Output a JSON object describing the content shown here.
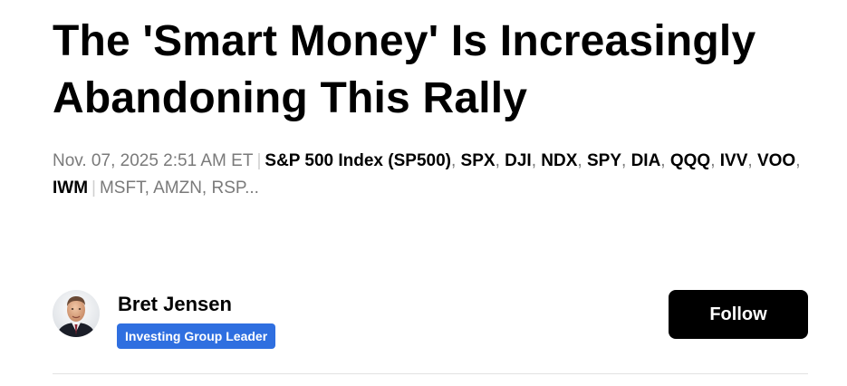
{
  "article": {
    "title": "The 'Smart Money' Is Increasingly Abandoning This Rally",
    "published": "Nov. 07, 2025 2:51 AM ET",
    "separator": "|",
    "primary_tickers": [
      "S&P 500 Index (SP500)",
      "SPX",
      "DJI",
      "NDX",
      "SPY",
      "DIA",
      "QQQ",
      "IVV",
      "VOO",
      "IWM"
    ],
    "secondary_tickers": "MSFT, AMZN, RSP...",
    "comma": ","
  },
  "author": {
    "name": "Bret Jensen",
    "badge": "Investing Group Leader",
    "avatar_icon": "author-photo"
  },
  "actions": {
    "follow_label": "Follow"
  },
  "colors": {
    "badge_bg": "#2f6fe0",
    "follow_bg": "#000000",
    "meta_gray": "#7a7a7a"
  }
}
